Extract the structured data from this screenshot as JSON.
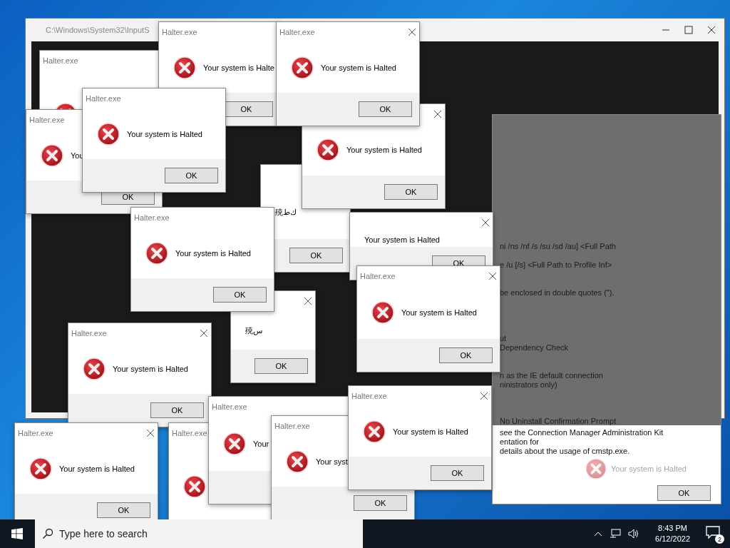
{
  "background_window": {
    "title": "C:\\Windows\\System32\\InputS"
  },
  "help_window": {
    "lines": [
      "ni /ns /nf /s /su /sd /au] <Full Path",
      "e /u [/s] <Full Path to Profile Inf>",
      "be enclosed in double quotes (\").",
      "ut",
      "Dependency Check",
      "n as the IE default connection",
      "ninistrators only)",
      "No Uninstall Confirmation Prompt"
    ],
    "footer_lines": [
      "see the Connection Manager Administration Kit",
      "entation for",
      "details about the usage of cmstp.exe."
    ],
    "faint_message": "Your system is Halted",
    "button": "OK"
  },
  "dialogs": [
    {
      "title": "Halter.exe",
      "icon": true,
      "close": false
    },
    {
      "title": "Halter.exe",
      "message": "You",
      "icon": true,
      "button": "OK",
      "close": false
    },
    {
      "title": "Halter.exe",
      "message": "Your system is Halte",
      "icon": true,
      "button": "OK",
      "close": false
    },
    {
      "title": "Halter.exe",
      "message": "Your system is Halted",
      "icon": true,
      "button": "OK",
      "close": false
    },
    {
      "message": "殑ﻙﻁ",
      "icon": false,
      "button": "OK"
    },
    {
      "message": "殑ﺱ",
      "icon": false,
      "button": "OK",
      "close": true
    },
    {
      "title": "Halter.exe",
      "message": "Your system is Halted",
      "icon": true,
      "button": "OK",
      "close": false
    },
    {
      "message": "Your system is Halted",
      "icon": true,
      "button": "OK",
      "close": true
    },
    {
      "message": "Your system is Halted",
      "icon": false,
      "button": "OK",
      "close": true
    },
    {
      "title": "Halter.exe",
      "message": "Your system is Halted",
      "icon": true,
      "button": "OK",
      "close": true
    },
    {
      "title": "Halter.exe",
      "message": "Your system is Halted",
      "icon": true,
      "button": "OK",
      "close": true
    },
    {
      "title": "Halter.exe",
      "message": "Your system is Halted",
      "icon": true,
      "button": "OK",
      "close": true
    },
    {
      "title": "Halter.exe",
      "icon": true,
      "close": false
    },
    {
      "title": "Halter.exe",
      "message": "Your",
      "icon": true,
      "close": false
    },
    {
      "title": "Halter.exe",
      "message": "Your system is Halted",
      "icon": true,
      "button": "OK",
      "close": true
    },
    {
      "title": "Halter.exe",
      "message": "Your syst",
      "icon": true,
      "button": "OK",
      "close": false
    },
    {
      "title": "Halter.exe",
      "message": "Your system is Halted",
      "icon": true,
      "button": "OK",
      "close": true
    }
  ],
  "taskbar": {
    "search_placeholder": "Type here to search",
    "time": "8:43 PM",
    "date": "6/12/2022",
    "notifications": "2"
  }
}
